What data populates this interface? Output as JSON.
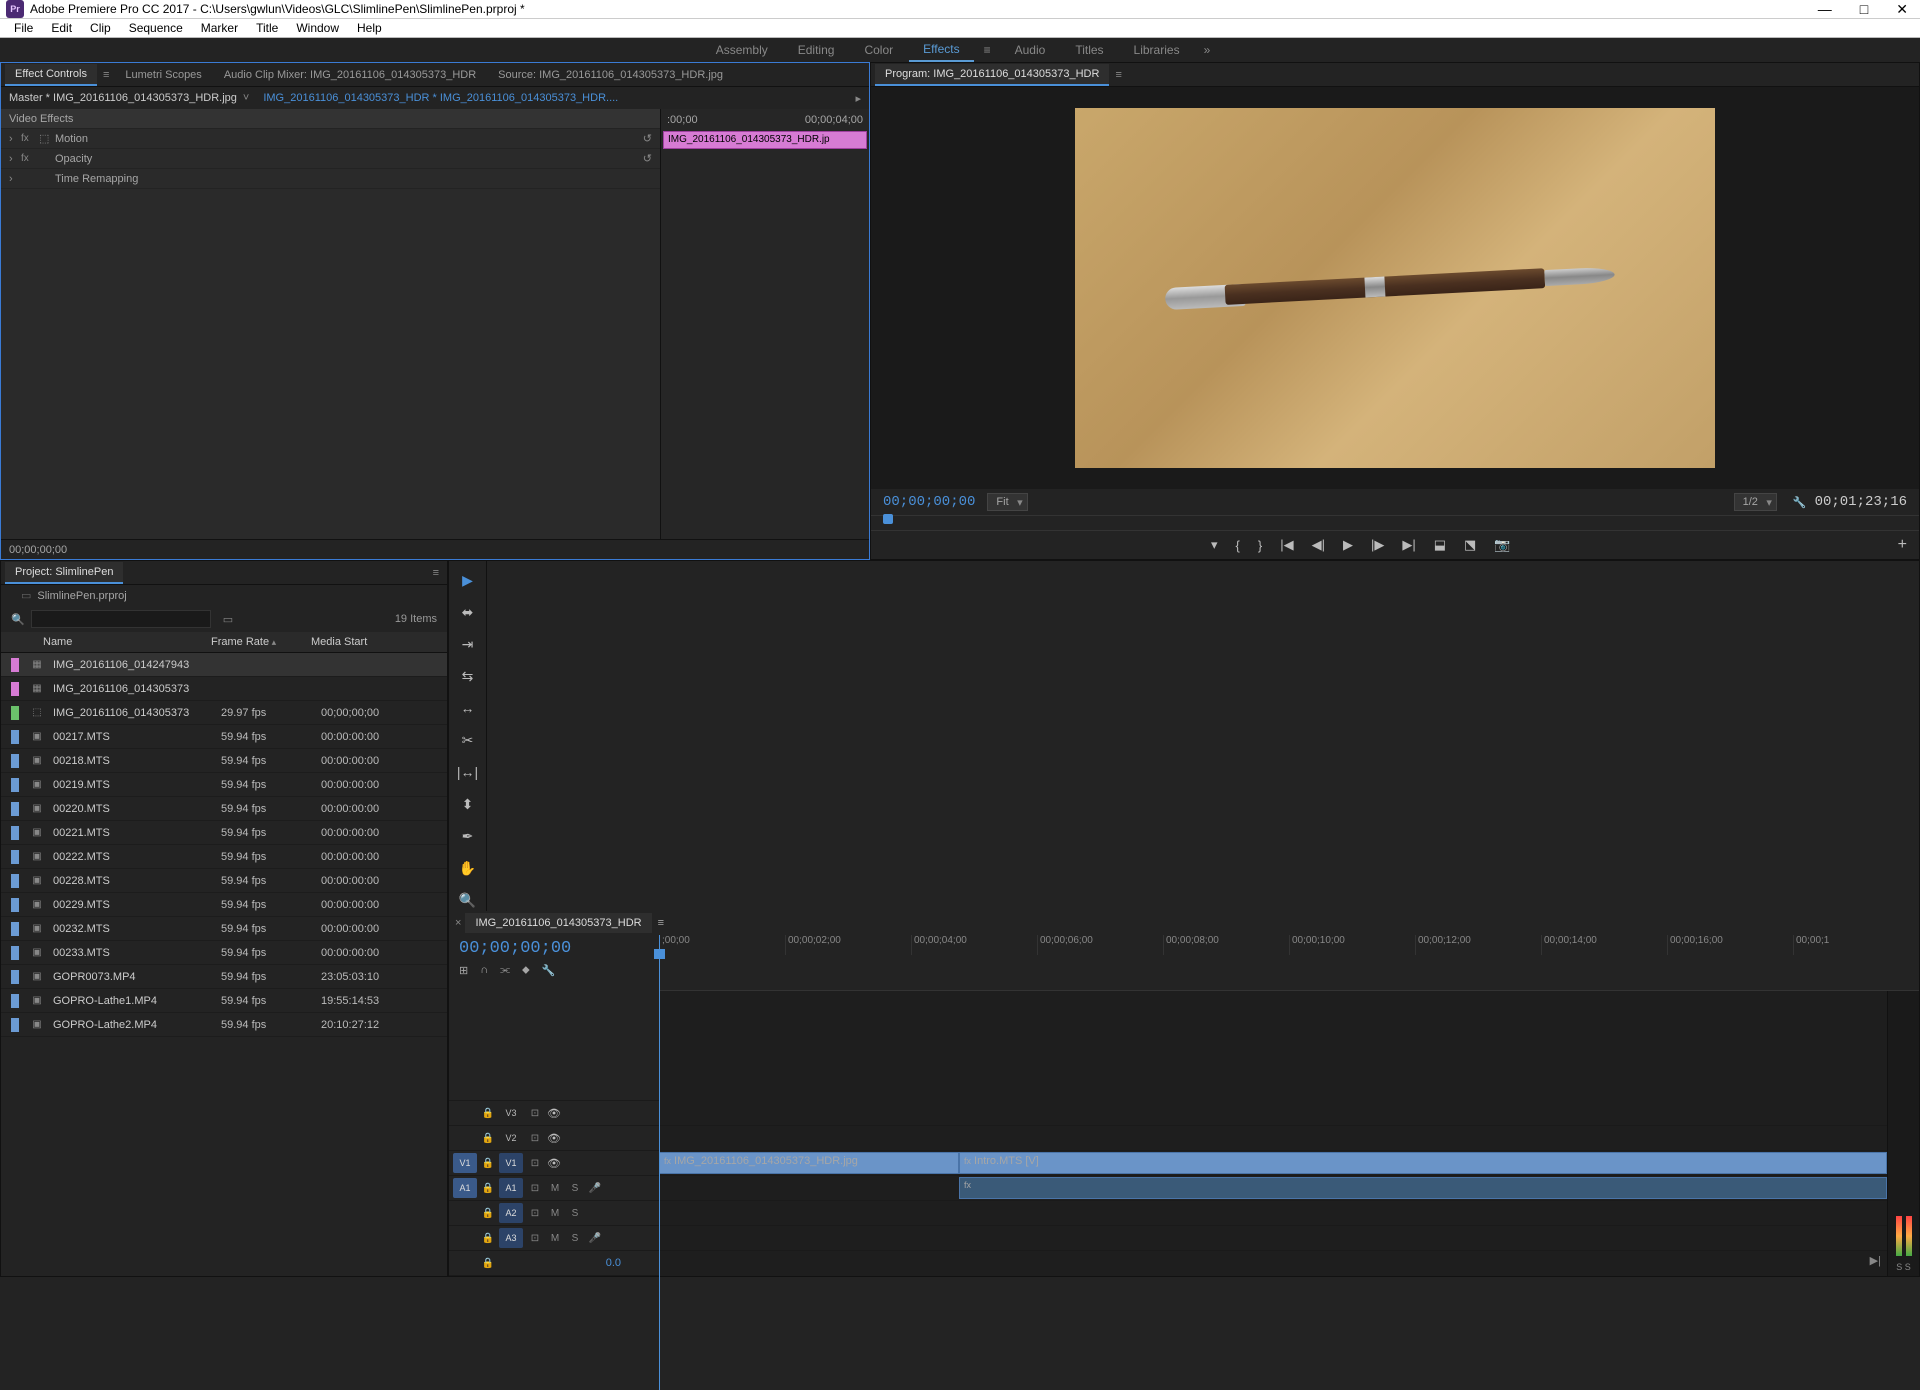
{
  "titlebar": {
    "badge": "Pr",
    "title": "Adobe Premiere Pro CC 2017 - C:\\Users\\gwlun\\Videos\\GLC\\SlimlinePen\\SlimlinePen.prproj *"
  },
  "menubar": [
    "File",
    "Edit",
    "Clip",
    "Sequence",
    "Marker",
    "Title",
    "Window",
    "Help"
  ],
  "workspaces": {
    "items": [
      "Assembly",
      "Editing",
      "Color",
      "Effects",
      "Audio",
      "Titles",
      "Libraries"
    ],
    "active": "Effects"
  },
  "effectControls": {
    "tabs": [
      "Effect Controls",
      "Lumetri Scopes",
      "Audio Clip Mixer: IMG_20161106_014305373_HDR",
      "Source: IMG_20161106_014305373_HDR.jpg"
    ],
    "master": "Master * IMG_20161106_014305373_HDR.jpg",
    "sequence": "IMG_20161106_014305373_HDR * IMG_20161106_014305373_HDR....",
    "ruler": {
      "start": ":00;00",
      "end": "00;00;04;00"
    },
    "clipLabel": "IMG_20161106_014305373_HDR.jp",
    "section": "Video Effects",
    "props": [
      {
        "name": "Motion",
        "hasIcon": true
      },
      {
        "name": "Opacity",
        "hasIcon": false
      },
      {
        "name": "Time Remapping",
        "hasIcon": false,
        "noFx": true
      }
    ],
    "footerTime": "00;00;00;00"
  },
  "program": {
    "tab": "Program: IMG_20161106_014305373_HDR",
    "timecodeLeft": "00;00;00;00",
    "fit": "Fit",
    "resolution": "1/2",
    "timecodeRight": "00;01;23;16"
  },
  "project": {
    "tab": "Project: SlimlinePen",
    "file": "SlimlinePen.prproj",
    "itemCount": "19 Items",
    "columns": {
      "name": "Name",
      "rate": "Frame Rate",
      "start": "Media Start"
    },
    "items": [
      {
        "swatch": "pink",
        "type": "img",
        "name": "IMG_20161106_014247943",
        "rate": "",
        "start": "",
        "sel": true
      },
      {
        "swatch": "pink",
        "type": "img",
        "name": "IMG_20161106_014305373",
        "rate": "",
        "start": ""
      },
      {
        "swatch": "green",
        "type": "seq",
        "name": "IMG_20161106_014305373",
        "rate": "29.97 fps",
        "start": "00;00;00;00"
      },
      {
        "swatch": "blue",
        "type": "vid",
        "name": "00217.MTS",
        "rate": "59.94 fps",
        "start": "00:00:00:00"
      },
      {
        "swatch": "blue",
        "type": "vid",
        "name": "00218.MTS",
        "rate": "59.94 fps",
        "start": "00:00:00:00"
      },
      {
        "swatch": "blue",
        "type": "vid",
        "name": "00219.MTS",
        "rate": "59.94 fps",
        "start": "00:00:00:00"
      },
      {
        "swatch": "blue",
        "type": "vid",
        "name": "00220.MTS",
        "rate": "59.94 fps",
        "start": "00:00:00:00"
      },
      {
        "swatch": "blue",
        "type": "vid",
        "name": "00221.MTS",
        "rate": "59.94 fps",
        "start": "00:00:00:00"
      },
      {
        "swatch": "blue",
        "type": "vid",
        "name": "00222.MTS",
        "rate": "59.94 fps",
        "start": "00:00:00:00"
      },
      {
        "swatch": "blue",
        "type": "vid",
        "name": "00228.MTS",
        "rate": "59.94 fps",
        "start": "00:00:00:00"
      },
      {
        "swatch": "blue",
        "type": "vid",
        "name": "00229.MTS",
        "rate": "59.94 fps",
        "start": "00:00:00:00"
      },
      {
        "swatch": "blue",
        "type": "vid",
        "name": "00232.MTS",
        "rate": "59.94 fps",
        "start": "00:00:00:00"
      },
      {
        "swatch": "blue",
        "type": "vid",
        "name": "00233.MTS",
        "rate": "59.94 fps",
        "start": "00:00:00:00"
      },
      {
        "swatch": "blue",
        "type": "vid",
        "name": "GOPR0073.MP4",
        "rate": "59.94 fps",
        "start": "23:05:03:10"
      },
      {
        "swatch": "blue",
        "type": "vid",
        "name": "GOPRO-Lathe1.MP4",
        "rate": "59.94 fps",
        "start": "19:55:14:53"
      },
      {
        "swatch": "blue",
        "type": "vid",
        "name": "GOPRO-Lathe2.MP4",
        "rate": "59.94 fps",
        "start": "20:10:27:12"
      }
    ]
  },
  "timeline": {
    "tab": "IMG_20161106_014305373_HDR",
    "timecode": "00;00;00;00",
    "ruler": [
      ";00;00",
      "00;00;02;00",
      "00;00;04;00",
      "00;00;06;00",
      "00;00;08;00",
      "00;00;10;00",
      "00;00;12;00",
      "00;00;14;00",
      "00;00;16;00",
      "00;00;1"
    ],
    "videoTracks": [
      {
        "label": "V3"
      },
      {
        "label": "V2"
      },
      {
        "label": "V1",
        "source": "V1"
      }
    ],
    "audioTracks": [
      {
        "label": "A1",
        "source": "A1"
      },
      {
        "label": "A2"
      },
      {
        "label": "A3"
      }
    ],
    "zoom": "0.0",
    "clips": {
      "v1a": "IMG_20161106_014305373_HDR.jpg",
      "v1b": "Intro.MTS [V]"
    },
    "meterLabel": "S S"
  }
}
